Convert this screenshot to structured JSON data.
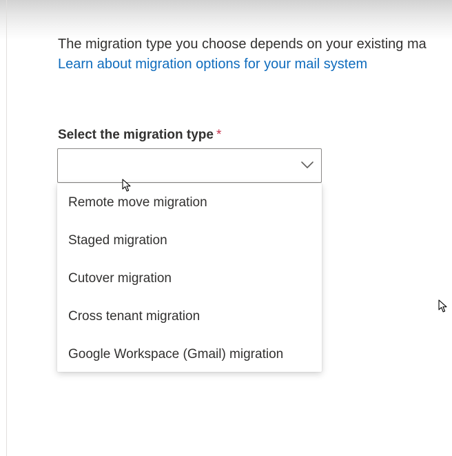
{
  "intro": {
    "text": "The migration type you choose depends on your existing ma",
    "link": "Learn about migration options for your mail system"
  },
  "field": {
    "label": "Select the migration type",
    "required_mark": "*",
    "value": ""
  },
  "options": [
    "Remote move migration",
    "Staged migration",
    "Cutover migration",
    "Cross tenant migration",
    "Google Workspace (Gmail) migration"
  ],
  "icons": {
    "dropdown": "chevron-down-icon",
    "pointer": "mouse-pointer-icon"
  },
  "colors": {
    "link": "#0f6cbd",
    "text": "#323130",
    "required": "#c4314b",
    "border": "#8a8886"
  }
}
